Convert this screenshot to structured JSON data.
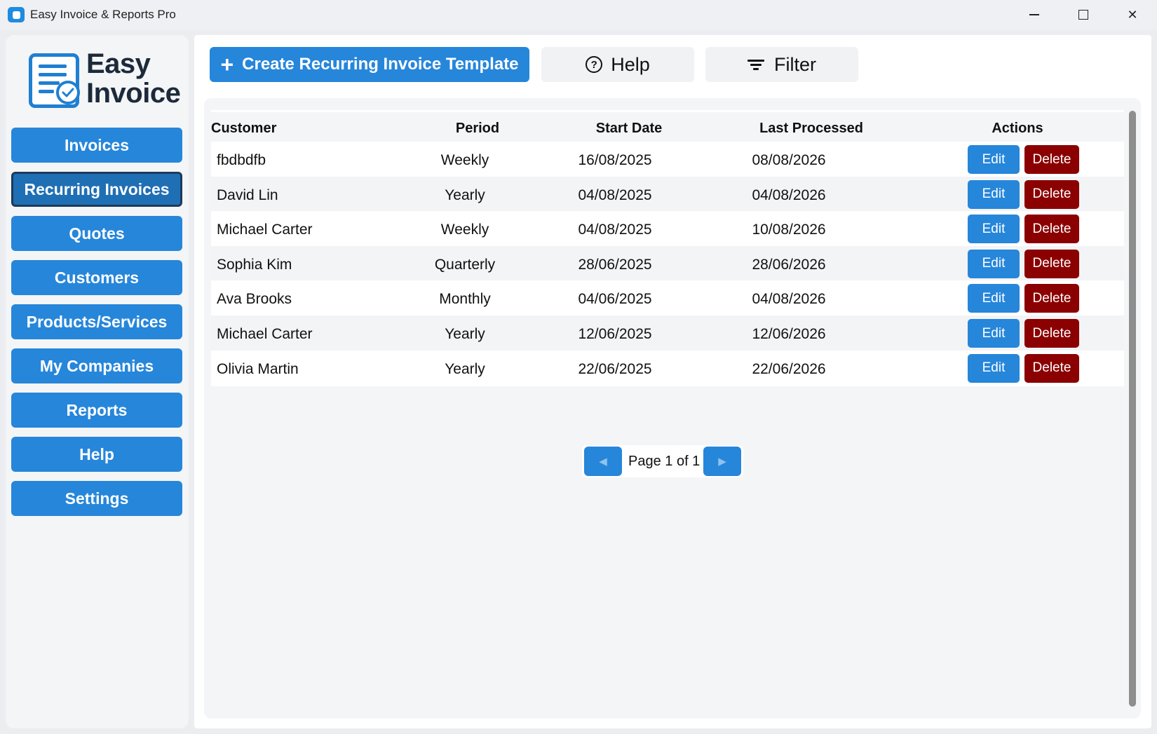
{
  "window": {
    "title": "Easy Invoice & Reports Pro",
    "minimize_glyph": "",
    "close_glyph": "✕"
  },
  "sidebar": {
    "logo": {
      "line1": "Easy",
      "line2": "Invoice"
    },
    "items": [
      {
        "label": "Invoices",
        "active": false
      },
      {
        "label": "Recurring Invoices",
        "active": true
      },
      {
        "label": "Quotes",
        "active": false
      },
      {
        "label": "Customers",
        "active": false
      },
      {
        "label": "Products/Services",
        "active": false
      },
      {
        "label": "My Companies",
        "active": false
      },
      {
        "label": "Reports",
        "active": false
      },
      {
        "label": "Help",
        "active": false
      },
      {
        "label": "Settings",
        "active": false
      }
    ]
  },
  "toolbar": {
    "create_icon": "+",
    "create_label": "Create Recurring Invoice Template",
    "help_icon": "?",
    "help_label": "Help",
    "filter_label": "Filter"
  },
  "table": {
    "headers": {
      "customer": "Customer",
      "period": "Period",
      "start_date": "Start Date",
      "last_processed": "Last Processed",
      "actions": "Actions"
    },
    "rows": [
      {
        "customer": "fbdbdfb",
        "period": "Weekly",
        "start_date": "16/08/2025",
        "last_processed": "08/08/2026",
        "edit": "Edit",
        "delete": "Delete"
      },
      {
        "customer": "David Lin",
        "period": "Yearly",
        "start_date": "04/08/2025",
        "last_processed": "04/08/2026",
        "edit": "Edit",
        "delete": "Delete"
      },
      {
        "customer": "Michael Carter",
        "period": "Weekly",
        "start_date": "04/08/2025",
        "last_processed": "10/08/2026",
        "edit": "Edit",
        "delete": "Delete"
      },
      {
        "customer": "Sophia Kim",
        "period": "Quarterly",
        "start_date": "28/06/2025",
        "last_processed": "28/06/2026",
        "edit": "Edit",
        "delete": "Delete"
      },
      {
        "customer": "Ava Brooks",
        "period": "Monthly",
        "start_date": "04/06/2025",
        "last_processed": "04/08/2026",
        "edit": "Edit",
        "delete": "Delete"
      },
      {
        "customer": "Michael Carter",
        "period": "Yearly",
        "start_date": "12/06/2025",
        "last_processed": "12/06/2026",
        "edit": "Edit",
        "delete": "Delete"
      },
      {
        "customer": "Olivia Martin",
        "period": "Yearly",
        "start_date": "22/06/2025",
        "last_processed": "22/06/2026",
        "edit": "Edit",
        "delete": "Delete"
      }
    ]
  },
  "pagination": {
    "prev_glyph": "◀",
    "label": "Page 1 of 1",
    "next_glyph": "▶"
  },
  "colors": {
    "accent": "#2686da",
    "danger": "#8b0000",
    "active_nav_border": "#1b3b5c"
  }
}
